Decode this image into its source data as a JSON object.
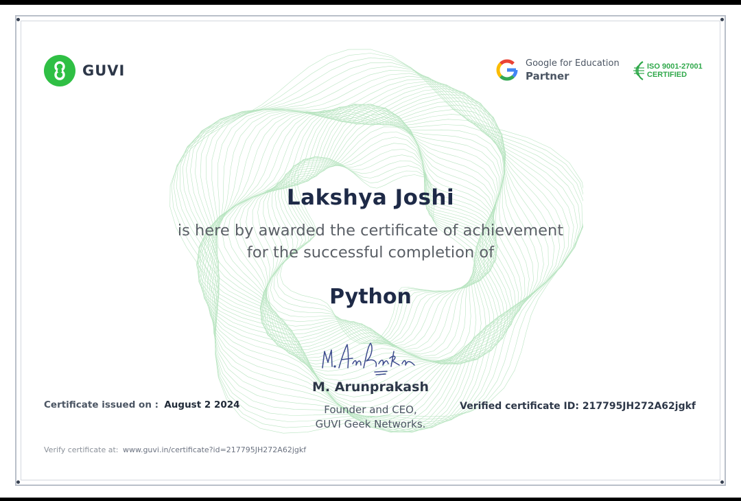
{
  "header": {
    "brand_name": "GUVI",
    "google_line1": "Google for Education",
    "google_line2": "Partner",
    "iso_line1": "ISO 9001-27001",
    "iso_line2": "CERTIFIED"
  },
  "certificate": {
    "recipient_name": "Lakshya Joshi",
    "award_line1": "is here by awarded the certificate of achievement",
    "award_line2": "for the successful completion of",
    "course_name": "Python",
    "signature_text": "M. Arunprakash",
    "signer_name": "M. Arunprakash",
    "signer_title_line1": "Founder and CEO,",
    "signer_title_line2": "GUVI Geek Networks."
  },
  "footer": {
    "issued_label": "Certificate issued on :",
    "issued_date": "August 2 2024",
    "verified_label": "Verified certificate ID:",
    "certificate_id": "217795JH272A62jgkf",
    "verify_label": "Verify certificate at:",
    "verify_url": "www.guvi.in/certificate?id=217795JH272A62jgkf"
  },
  "colors": {
    "brand_green": "#2fbf44",
    "heading_navy": "#1e2a47",
    "border_gray": "#b9bfc9"
  },
  "icons": [
    "guvi-logo-icon",
    "google-g-icon",
    "iso-globe-icon"
  ]
}
